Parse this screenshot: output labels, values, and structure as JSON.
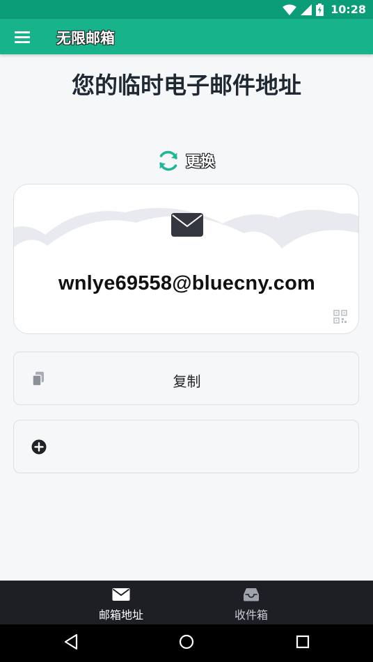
{
  "status_bar": {
    "time": "10:28"
  },
  "app_bar": {
    "title": "无限邮箱"
  },
  "main": {
    "page_title": "您的临时电子邮件地址",
    "refresh_label": "更换",
    "email_address": "wnlye69558@bluecny.com",
    "copy_label": "复制"
  },
  "bottom_nav": {
    "items": [
      {
        "label": "邮箱地址",
        "icon": "envelope-icon",
        "active": true
      },
      {
        "label": "收件箱",
        "icon": "inbox-icon",
        "active": false
      }
    ]
  },
  "colors": {
    "status_bar": "#0b9c78",
    "app_bar": "#17b48b",
    "accent": "#1fb896",
    "bottom_nav": "#1d1f24",
    "background": "#f6f7f9"
  }
}
